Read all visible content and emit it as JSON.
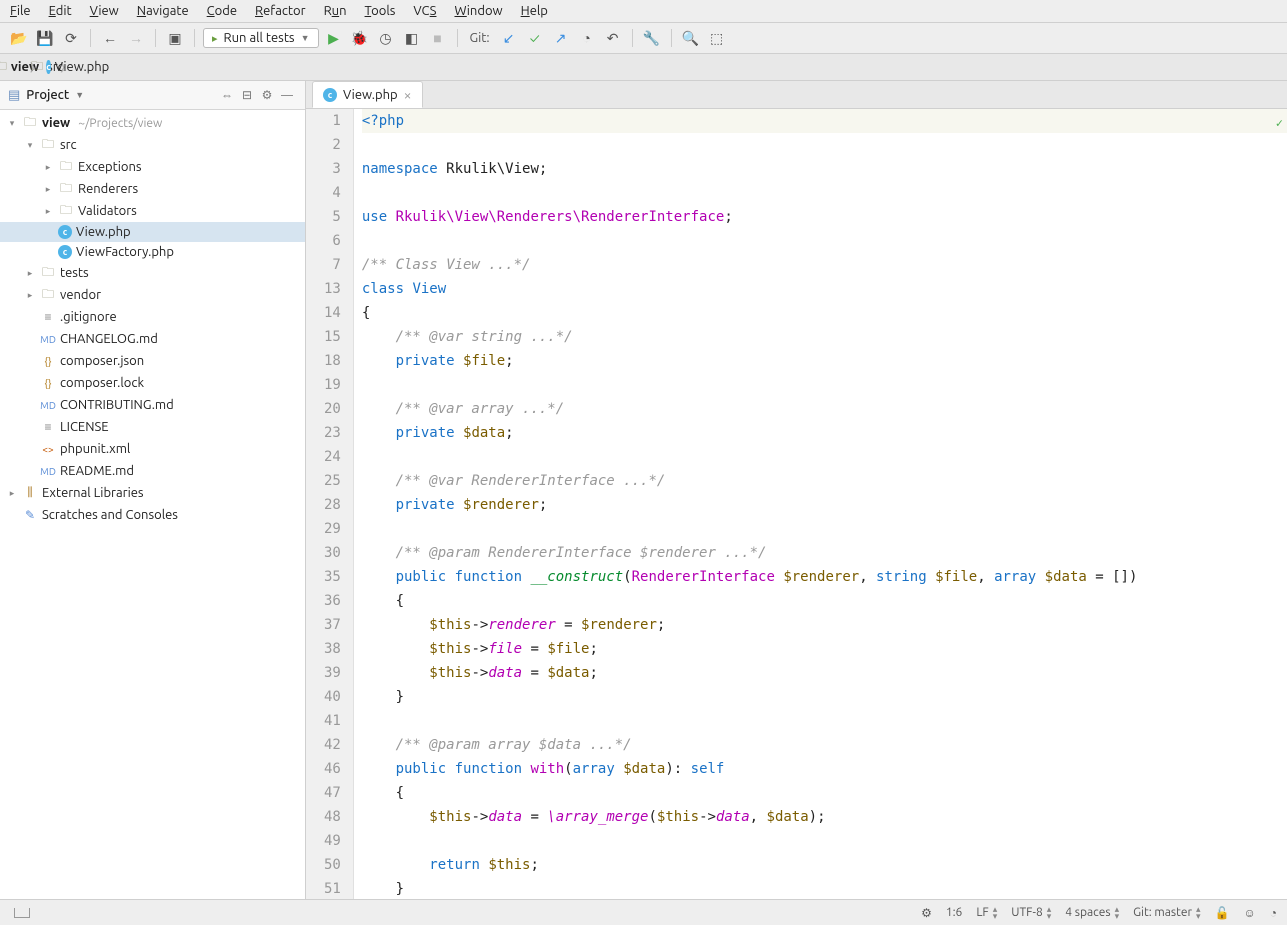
{
  "menu": [
    "File",
    "Edit",
    "View",
    "Navigate",
    "Code",
    "Refactor",
    "Run",
    "Tools",
    "VCS",
    "Window",
    "Help"
  ],
  "menu_underline_idx": [
    0,
    0,
    0,
    0,
    0,
    0,
    1,
    0,
    2,
    0,
    0
  ],
  "run_config": "Run all tests",
  "git_label": "Git:",
  "breadcrumb": [
    {
      "icon": "folder",
      "label": "view",
      "bold": true
    },
    {
      "icon": "folder",
      "label": "src"
    },
    {
      "icon": "php",
      "label": "View.php"
    }
  ],
  "sidebar": {
    "title": "Project"
  },
  "tree": [
    {
      "d": 0,
      "tw": "open",
      "icon": "folder",
      "label": "view",
      "bold": true,
      "path": "~/Projects/view"
    },
    {
      "d": 1,
      "tw": "open",
      "icon": "folder",
      "label": "src"
    },
    {
      "d": 2,
      "tw": "closed",
      "icon": "folder",
      "label": "Exceptions"
    },
    {
      "d": 2,
      "tw": "closed",
      "icon": "folder",
      "label": "Renderers"
    },
    {
      "d": 2,
      "tw": "closed",
      "icon": "folder",
      "label": "Validators"
    },
    {
      "d": 2,
      "tw": "",
      "icon": "php",
      "label": "View.php",
      "sel": true
    },
    {
      "d": 2,
      "tw": "",
      "icon": "php",
      "label": "ViewFactory.php"
    },
    {
      "d": 1,
      "tw": "closed",
      "icon": "folder",
      "label": "tests"
    },
    {
      "d": 1,
      "tw": "closed",
      "icon": "folder",
      "label": "vendor"
    },
    {
      "d": 1,
      "tw": "",
      "icon": "txt",
      "label": ".gitignore"
    },
    {
      "d": 1,
      "tw": "",
      "icon": "md",
      "label": "CHANGELOG.md"
    },
    {
      "d": 1,
      "tw": "",
      "icon": "json",
      "label": "composer.json"
    },
    {
      "d": 1,
      "tw": "",
      "icon": "json",
      "label": "composer.lock"
    },
    {
      "d": 1,
      "tw": "",
      "icon": "md",
      "label": "CONTRIBUTING.md"
    },
    {
      "d": 1,
      "tw": "",
      "icon": "txt",
      "label": "LICENSE"
    },
    {
      "d": 1,
      "tw": "",
      "icon": "xml",
      "label": "phpunit.xml"
    },
    {
      "d": 1,
      "tw": "",
      "icon": "md",
      "label": "README.md"
    },
    {
      "d": 0,
      "tw": "closed",
      "icon": "lib",
      "label": "External Libraries"
    },
    {
      "d": 0,
      "tw": "",
      "icon": "scratch",
      "label": "Scratches and Consoles"
    }
  ],
  "tab": {
    "label": "View.php"
  },
  "code": {
    "gutter": [
      "1",
      "2",
      "3",
      "4",
      "5",
      "6",
      "7",
      "13",
      "14",
      "15",
      "18",
      "19",
      "20",
      "23",
      "24",
      "25",
      "28",
      "29",
      "30",
      "35",
      "36",
      "37",
      "38",
      "39",
      "40",
      "41",
      "42",
      "46",
      "47",
      "48",
      "49",
      "50",
      "51"
    ],
    "lines": [
      {
        "cur": true,
        "seg": [
          [
            "<?php",
            "kw"
          ]
        ]
      },
      {
        "seg": [
          [
            "",
            ""
          ]
        ]
      },
      {
        "seg": [
          [
            "namespace ",
            "kw"
          ],
          [
            "Rkulik\\View",
            ""
          ],
          [
            ";",
            ""
          ]
        ]
      },
      {
        "seg": [
          [
            "",
            ""
          ]
        ]
      },
      {
        "seg": [
          [
            "use ",
            "kw"
          ],
          [
            "Rkulik\\View\\Renderers\\RendererInterface",
            "ns"
          ],
          [
            ";",
            ""
          ]
        ]
      },
      {
        "seg": [
          [
            "",
            ""
          ]
        ]
      },
      {
        "seg": [
          [
            "/** Class View ...*/",
            "cm"
          ]
        ]
      },
      {
        "seg": [
          [
            "class ",
            "kw"
          ],
          [
            "View",
            "cls"
          ]
        ]
      },
      {
        "seg": [
          [
            "{",
            ""
          ]
        ]
      },
      {
        "seg": [
          [
            "    ",
            ""
          ],
          [
            "/** @var string ...*/",
            "cm"
          ]
        ]
      },
      {
        "seg": [
          [
            "    ",
            ""
          ],
          [
            "private ",
            "kw"
          ],
          [
            "$file",
            "var"
          ],
          [
            ";",
            ""
          ]
        ]
      },
      {
        "seg": [
          [
            "",
            ""
          ]
        ]
      },
      {
        "seg": [
          [
            "    ",
            ""
          ],
          [
            "/** @var array ...*/",
            "cm"
          ]
        ]
      },
      {
        "seg": [
          [
            "    ",
            ""
          ],
          [
            "private ",
            "kw"
          ],
          [
            "$data",
            "var"
          ],
          [
            ";",
            ""
          ]
        ]
      },
      {
        "seg": [
          [
            "",
            ""
          ]
        ]
      },
      {
        "seg": [
          [
            "    ",
            ""
          ],
          [
            "/** @var RendererInterface ...*/",
            "cm"
          ]
        ]
      },
      {
        "seg": [
          [
            "    ",
            ""
          ],
          [
            "private ",
            "kw"
          ],
          [
            "$renderer",
            "var"
          ],
          [
            ";",
            ""
          ]
        ]
      },
      {
        "seg": [
          [
            "",
            ""
          ]
        ]
      },
      {
        "seg": [
          [
            "    ",
            ""
          ],
          [
            "/** @param RendererInterface $renderer ...*/",
            "cm"
          ]
        ]
      },
      {
        "seg": [
          [
            "    ",
            ""
          ],
          [
            "public ",
            "kw"
          ],
          [
            "function ",
            "kw"
          ],
          [
            "__construct",
            "magic"
          ],
          [
            "(",
            ""
          ],
          [
            "RendererInterface ",
            "ns"
          ],
          [
            "$renderer",
            "var"
          ],
          [
            ", ",
            ""
          ],
          [
            "string ",
            "kw"
          ],
          [
            "$file",
            "var"
          ],
          [
            ", ",
            ""
          ],
          [
            "array ",
            "kw"
          ],
          [
            "$data",
            "var"
          ],
          [
            " = [])",
            ""
          ]
        ]
      },
      {
        "seg": [
          [
            "    {",
            ""
          ]
        ]
      },
      {
        "seg": [
          [
            "        ",
            ""
          ],
          [
            "$this",
            "var"
          ],
          [
            "->",
            ""
          ],
          [
            "renderer",
            "fn"
          ],
          [
            " = ",
            ""
          ],
          [
            "$renderer",
            "var"
          ],
          [
            ";",
            ""
          ]
        ]
      },
      {
        "seg": [
          [
            "        ",
            ""
          ],
          [
            "$this",
            "var"
          ],
          [
            "->",
            ""
          ],
          [
            "file",
            "fn"
          ],
          [
            " = ",
            ""
          ],
          [
            "$file",
            "var"
          ],
          [
            ";",
            ""
          ]
        ]
      },
      {
        "seg": [
          [
            "        ",
            ""
          ],
          [
            "$this",
            "var"
          ],
          [
            "->",
            ""
          ],
          [
            "data",
            "fn"
          ],
          [
            " = ",
            ""
          ],
          [
            "$data",
            "var"
          ],
          [
            ";",
            ""
          ]
        ]
      },
      {
        "seg": [
          [
            "    }",
            ""
          ]
        ]
      },
      {
        "seg": [
          [
            "",
            ""
          ]
        ]
      },
      {
        "seg": [
          [
            "    ",
            ""
          ],
          [
            "/** @param array $data ...*/",
            "cm"
          ]
        ]
      },
      {
        "seg": [
          [
            "    ",
            ""
          ],
          [
            "public ",
            "kw"
          ],
          [
            "function ",
            "kw"
          ],
          [
            "with",
            "ns"
          ],
          [
            "(",
            ""
          ],
          [
            "array ",
            "kw"
          ],
          [
            "$data",
            "var"
          ],
          [
            "): ",
            ""
          ],
          [
            "self",
            "self"
          ]
        ]
      },
      {
        "seg": [
          [
            "    {",
            ""
          ]
        ]
      },
      {
        "seg": [
          [
            "        ",
            ""
          ],
          [
            "$this",
            "var"
          ],
          [
            "->",
            ""
          ],
          [
            "data",
            "fn"
          ],
          [
            " = ",
            ""
          ],
          [
            "\\array_merge",
            "fn"
          ],
          [
            "(",
            ""
          ],
          [
            "$this",
            "var"
          ],
          [
            "->",
            ""
          ],
          [
            "data",
            "fn"
          ],
          [
            ", ",
            ""
          ],
          [
            "$data",
            "var"
          ],
          [
            ");",
            ""
          ]
        ]
      },
      {
        "seg": [
          [
            "",
            ""
          ]
        ]
      },
      {
        "seg": [
          [
            "        ",
            ""
          ],
          [
            "return ",
            "kw"
          ],
          [
            "$this",
            "var"
          ],
          [
            ";",
            ""
          ]
        ]
      },
      {
        "seg": [
          [
            "    }",
            ""
          ]
        ]
      }
    ]
  },
  "status": {
    "cursor": "1:6",
    "line_sep": "LF",
    "encoding": "UTF-8",
    "indent": "4 spaces",
    "git": "Git: master"
  }
}
